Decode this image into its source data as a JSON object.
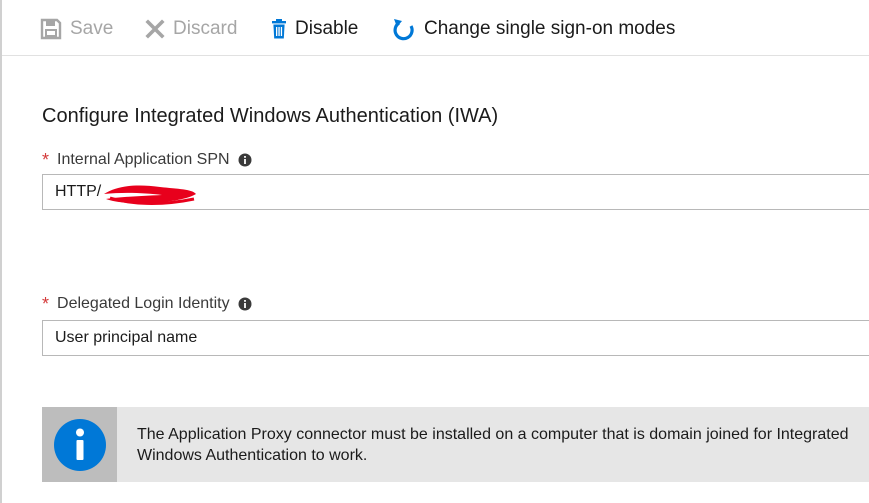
{
  "toolbar": {
    "save_label": "Save",
    "discard_label": "Discard",
    "disable_label": "Disable",
    "change_modes_label": "Change single sign-on modes",
    "icons": {
      "save": "save-icon",
      "discard": "close-icon",
      "disable": "trash-icon",
      "change_modes": "refresh-icon"
    },
    "save_enabled": false,
    "discard_enabled": false
  },
  "form": {
    "section_title": "Configure Integrated Windows Authentication (IWA)",
    "spn": {
      "required_marker": "*",
      "label": "Internal Application SPN",
      "value": "HTTP/"
    },
    "login_identity": {
      "required_marker": "*",
      "label": "Delegated Login Identity",
      "value": "User principal name"
    }
  },
  "notice": {
    "text": "The Application Proxy connector must be installed on a computer that is domain joined for Integrated Windows Authentication to work."
  },
  "colors": {
    "accent": "#0078d7",
    "required": "#d43a3a",
    "redaction": "#e8001c",
    "info_bar_bg": "#e6e6e6"
  }
}
